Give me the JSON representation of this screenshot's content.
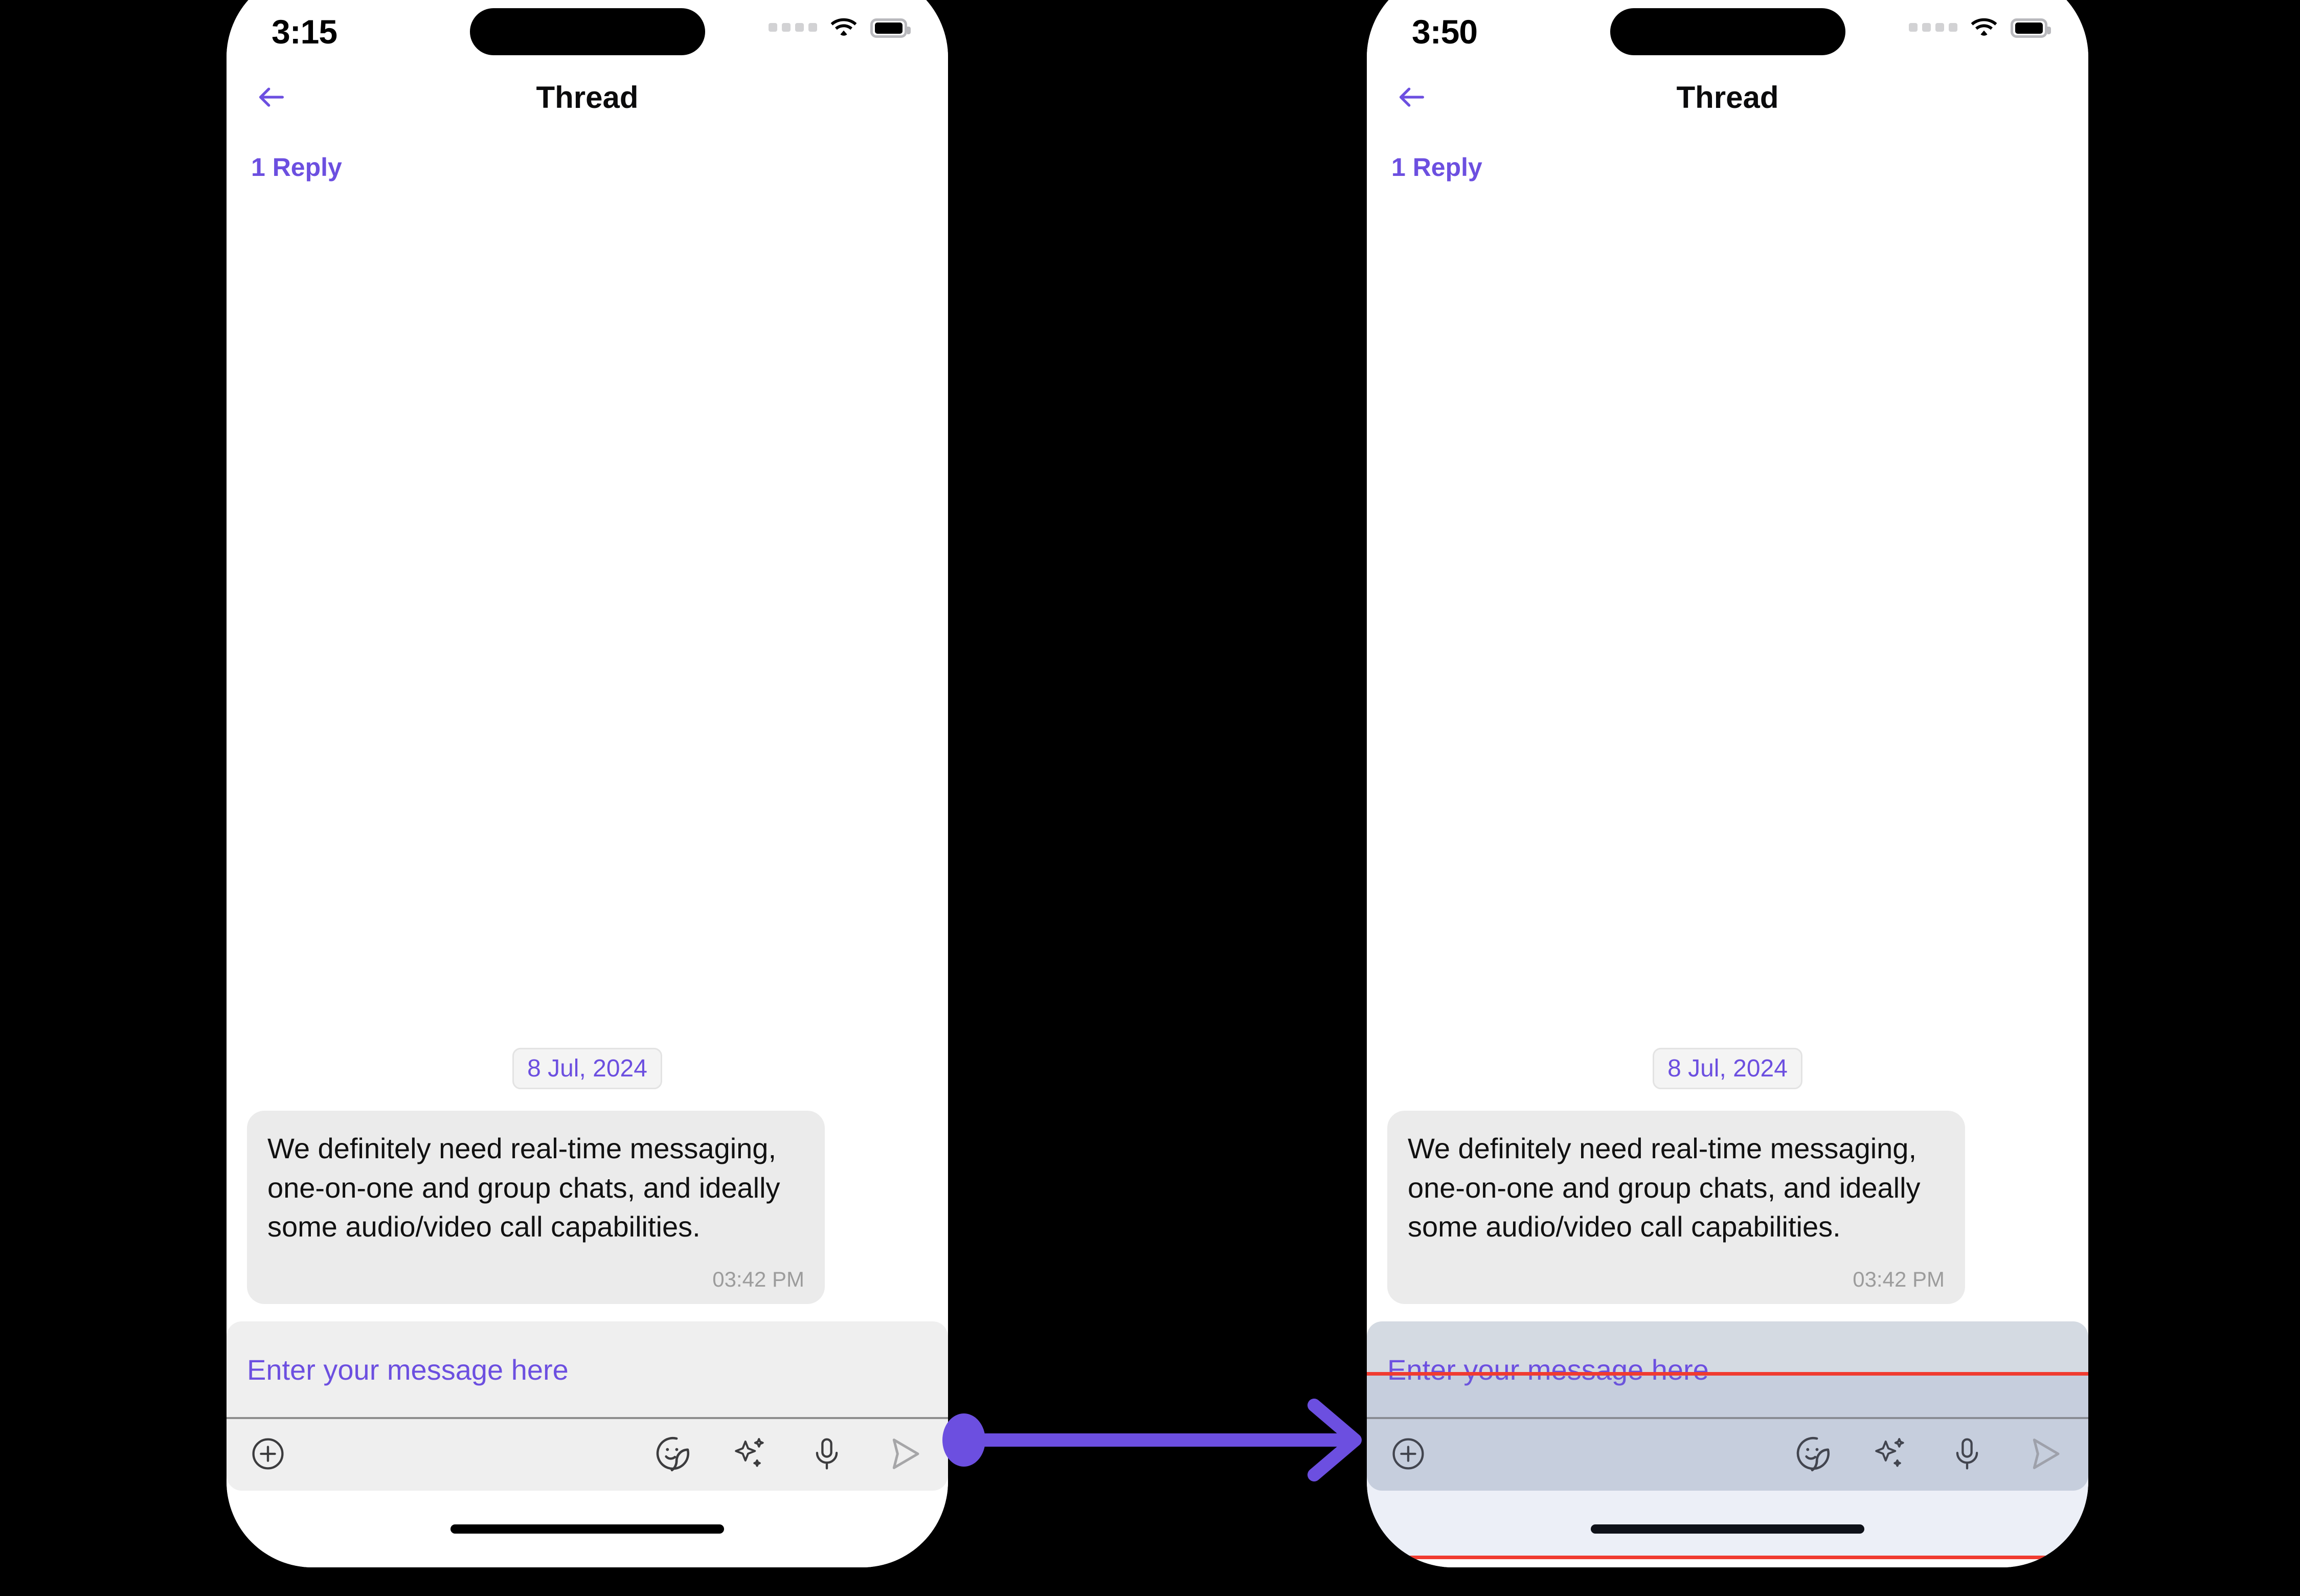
{
  "accent_color": "#6c4fe0",
  "annotation_color": "#f03b30",
  "bubble_color": "#ebebeb",
  "composer_color_before": "#efefef",
  "composer_color_after": "#d4dae2",
  "screens": [
    {
      "id": "before",
      "status_bar": {
        "time": "3:15",
        "signal_icon": "signal-dots-icon",
        "wifi_icon": "wifi-icon",
        "battery_icon": "battery-full-icon"
      },
      "nav": {
        "back_icon": "back-arrow-icon",
        "title": "Thread"
      },
      "reply_count": "1 Reply",
      "thread": {
        "date_pill": "8 Jul, 2024",
        "messages": [
          {
            "text": "We definitely need real-time messaging, one-on-one and group chats, and ideally some audio/video call capabilities.",
            "time": "03:42 PM",
            "side": "incoming"
          }
        ]
      },
      "composer": {
        "placeholder": "Enter your message here",
        "value": "",
        "tools": [
          {
            "name": "add-attachment-icon",
            "label": "Add"
          },
          {
            "name": "sticker-icon",
            "label": "Stickers"
          },
          {
            "name": "ai-sparkle-icon",
            "label": "AI"
          },
          {
            "name": "microphone-icon",
            "label": "Voice"
          },
          {
            "name": "send-icon",
            "label": "Send"
          }
        ]
      },
      "home_indicator": "home-indicator"
    },
    {
      "id": "after",
      "status_bar": {
        "time": "3:50",
        "signal_icon": "signal-dots-icon",
        "wifi_icon": "wifi-icon",
        "battery_icon": "battery-full-icon"
      },
      "nav": {
        "back_icon": "back-arrow-icon",
        "title": "Thread"
      },
      "reply_count": "1 Reply",
      "thread": {
        "date_pill": "8 Jul, 2024",
        "messages": [
          {
            "text": "We definitely need real-time messaging, one-on-one and group chats, and ideally some audio/video call capabilities.",
            "time": "03:42 PM",
            "side": "incoming"
          }
        ]
      },
      "composer": {
        "placeholder": "Enter your message here",
        "value": "",
        "tools": [
          {
            "name": "add-attachment-icon",
            "label": "Add"
          },
          {
            "name": "sticker-icon",
            "label": "Stickers"
          },
          {
            "name": "ai-sparkle-icon",
            "label": "AI"
          },
          {
            "name": "microphone-icon",
            "label": "Voice"
          },
          {
            "name": "send-icon",
            "label": "Send"
          }
        ]
      },
      "home_indicator": "home-indicator"
    }
  ],
  "connector": {
    "icon": "step-arrow-icon",
    "color": "#6c4fe0"
  }
}
